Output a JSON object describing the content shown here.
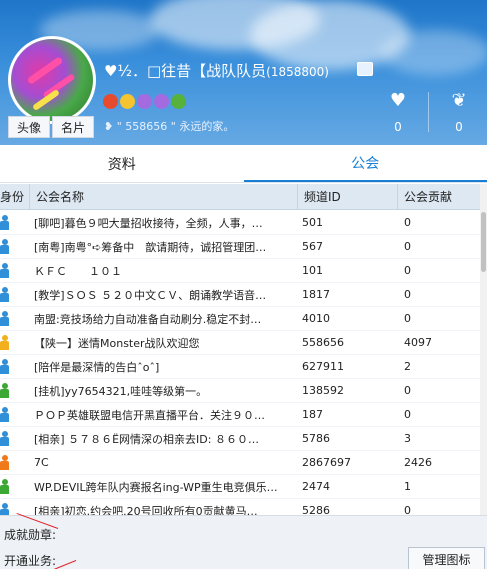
{
  "profile": {
    "nickname": "♥½．□往昔【战队队员",
    "qq_number": "(1858800)",
    "signature": "❥ \" 558656 \" 永远的家。",
    "avatar_button": "头像",
    "card_button": "名片",
    "likes": "0",
    "awards": "0"
  },
  "tabs": {
    "info": "资料",
    "guild": "公会"
  },
  "table": {
    "headers": {
      "identity": "身份",
      "name": "公会名称",
      "channel_id": "频道ID",
      "contribution": "公会贡献"
    },
    "rows": [
      {
        "name": "[聊吧]暮色９吧大量招收接待，全频，人事，…",
        "id": "501",
        "contrib": "0",
        "role": "member"
      },
      {
        "name": "[南粤]南粤°➪筹备中　歆请期待，诚招管理团…",
        "id": "567",
        "contrib": "0",
        "role": "member"
      },
      {
        "name": "ＫＦＣ　　１０１",
        "id": "101",
        "contrib": "0",
        "role": "member"
      },
      {
        "name": "[教学]ＳＯＳ ５２０中文ＣＶ、朗诵教学语音…",
        "id": "1817",
        "contrib": "0",
        "role": "member"
      },
      {
        "name": "南盟:竞技场给力自动准备自动刷分.稳定不封…",
        "id": "4010",
        "contrib": "0",
        "role": "member"
      },
      {
        "name": "【陕一】迷情Monster战队欢迎您",
        "id": "558656",
        "contrib": "4097",
        "role": "admin"
      },
      {
        "name": "[陪伴是最深情的告白ˆoˆ]",
        "id": "627911",
        "contrib": "2",
        "role": "member"
      },
      {
        "name": "[挂机]yy7654321,哇哇等级第一。",
        "id": "138592",
        "contrib": "0",
        "role": "green"
      },
      {
        "name": "ＰＯＰ英雄联盟电信开黑直播平台．关注９０…",
        "id": "187",
        "contrib": "0",
        "role": "member"
      },
      {
        "name": "[相亲] ５７８６Ё网情深の相亲去ID: ８６０…",
        "id": "5786",
        "contrib": "3",
        "role": "member"
      },
      {
        "name": "7C",
        "id": "2867697",
        "contrib": "2426",
        "role": "orange"
      },
      {
        "name": "WP.DEVIL跨年队内赛报名ing-WP重生电竞俱乐…",
        "id": "2474",
        "contrib": "1",
        "role": "green"
      },
      {
        "name": "[相亲]初恋.约会吧.20号回收所有0贡献黄马…",
        "id": "5286",
        "contrib": "0",
        "role": "member"
      }
    ]
  },
  "footer": {
    "honor_label": "成就勋章:",
    "business_label": "开通业务:",
    "manage_button": "管理图标"
  },
  "colors": {
    "member": "#2f8fd8",
    "admin": "#f2b01e",
    "green": "#3aa832",
    "orange": "#f07a1a",
    "accent": "#1a7fd4"
  }
}
